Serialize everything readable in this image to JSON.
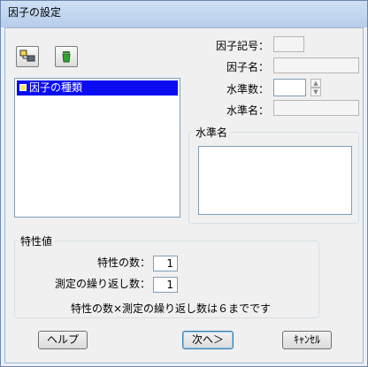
{
  "window": {
    "title": "因子の設定"
  },
  "toolbar": {
    "add_icon": "factor-add-icon",
    "delete_icon": "trash-icon"
  },
  "factor_list": {
    "items": [
      "因子の種類"
    ]
  },
  "form": {
    "factor_symbol_label": "因子記号：",
    "factor_symbol_value": "",
    "factor_name_label": "因子名：",
    "factor_name_value": "",
    "levels_label": "水準数：",
    "levels_value": "",
    "level_name_label": "水準名：",
    "level_name_value": "",
    "level_names_group_title": "水準名"
  },
  "characteristics": {
    "group_title": "特性値",
    "count_label": "特性の数：",
    "count_value": "1",
    "repeat_label": "測定の繰り返し数：",
    "repeat_value": "1",
    "note": "特性の数×測定の繰り返し数は６までです"
  },
  "buttons": {
    "help": "ヘルプ",
    "next": "次へ＞",
    "cancel": "ｷｬﾝｾﾙ"
  }
}
